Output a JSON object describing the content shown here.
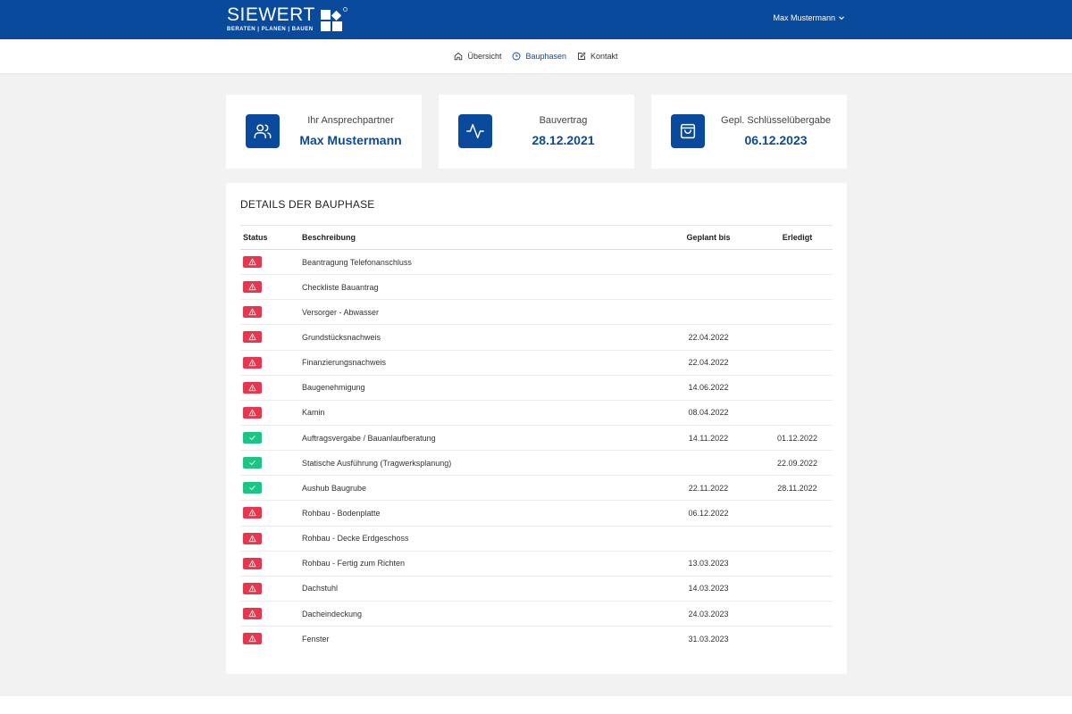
{
  "brand": {
    "name": "SIEWERT",
    "tagline": "BERATEN | PLANEN | BAUEN",
    "primary_color": "#0a4a9c"
  },
  "user_menu": {
    "name": "Max Mustermann",
    "icon": "chevron-down-icon"
  },
  "nav": [
    {
      "label": "Übersicht",
      "icon": "home-icon",
      "active": false
    },
    {
      "label": "Bauphasen",
      "icon": "clock-icon",
      "active": true
    },
    {
      "label": "Kontakt",
      "icon": "edit-icon",
      "active": false
    }
  ],
  "cards": [
    {
      "label": "Ihr Ansprechpartner",
      "value": "Max Mustermann",
      "icon": "users-icon"
    },
    {
      "label": "Bauvertrag",
      "value": "28.12.2021",
      "icon": "activity-icon"
    },
    {
      "label": "Gepl. Schlüsselübergabe",
      "value": "06.12.2023",
      "icon": "shopping-bag-icon"
    }
  ],
  "details": {
    "title": "DETAILS DER BAUPHASE",
    "columns": [
      "Status",
      "Beschreibung",
      "Geplant bis",
      "Erledigt"
    ],
    "status_colors": {
      "open": "#e8364f",
      "done": "#1cc584"
    },
    "rows": [
      {
        "status": "open",
        "description": "Beantragung Telefonanschluss",
        "planned": "",
        "done": ""
      },
      {
        "status": "open",
        "description": "Checkliste Bauantrag",
        "planned": "",
        "done": ""
      },
      {
        "status": "open",
        "description": "Versorger - Abwasser",
        "planned": "",
        "done": ""
      },
      {
        "status": "open",
        "description": "Grundstücksnachweis",
        "planned": "22.04.2022",
        "done": ""
      },
      {
        "status": "open",
        "description": "Finanzierungsnachweis",
        "planned": "22.04.2022",
        "done": ""
      },
      {
        "status": "open",
        "description": "Baugenehmigung",
        "planned": "14.06.2022",
        "done": ""
      },
      {
        "status": "open",
        "description": "Kamin",
        "planned": "08.04.2022",
        "done": ""
      },
      {
        "status": "done",
        "description": "Auftragsvergabe / Bauanlaufberatung",
        "planned": "14.11.2022",
        "done": "01.12.2022"
      },
      {
        "status": "done",
        "description": "Statische Ausführung (Tragwerksplanung)",
        "planned": "",
        "done": "22.09.2022"
      },
      {
        "status": "done",
        "description": "Aushub Baugrube",
        "planned": "22.11.2022",
        "done": "28.11.2022"
      },
      {
        "status": "open",
        "description": "Rohbau - Bodenplatte",
        "planned": "06.12.2022",
        "done": ""
      },
      {
        "status": "open",
        "description": "Rohbau - Decke Erdgeschoss",
        "planned": "",
        "done": ""
      },
      {
        "status": "open",
        "description": "Rohbau - Fertig zum Richten",
        "planned": "13.03.2023",
        "done": ""
      },
      {
        "status": "open",
        "description": "Dachstuhl",
        "planned": "14.03.2023",
        "done": ""
      },
      {
        "status": "open",
        "description": "Dacheindeckung",
        "planned": "24.03.2023",
        "done": ""
      },
      {
        "status": "open",
        "description": "Fenster",
        "planned": "31.03.2023",
        "done": ""
      }
    ]
  }
}
